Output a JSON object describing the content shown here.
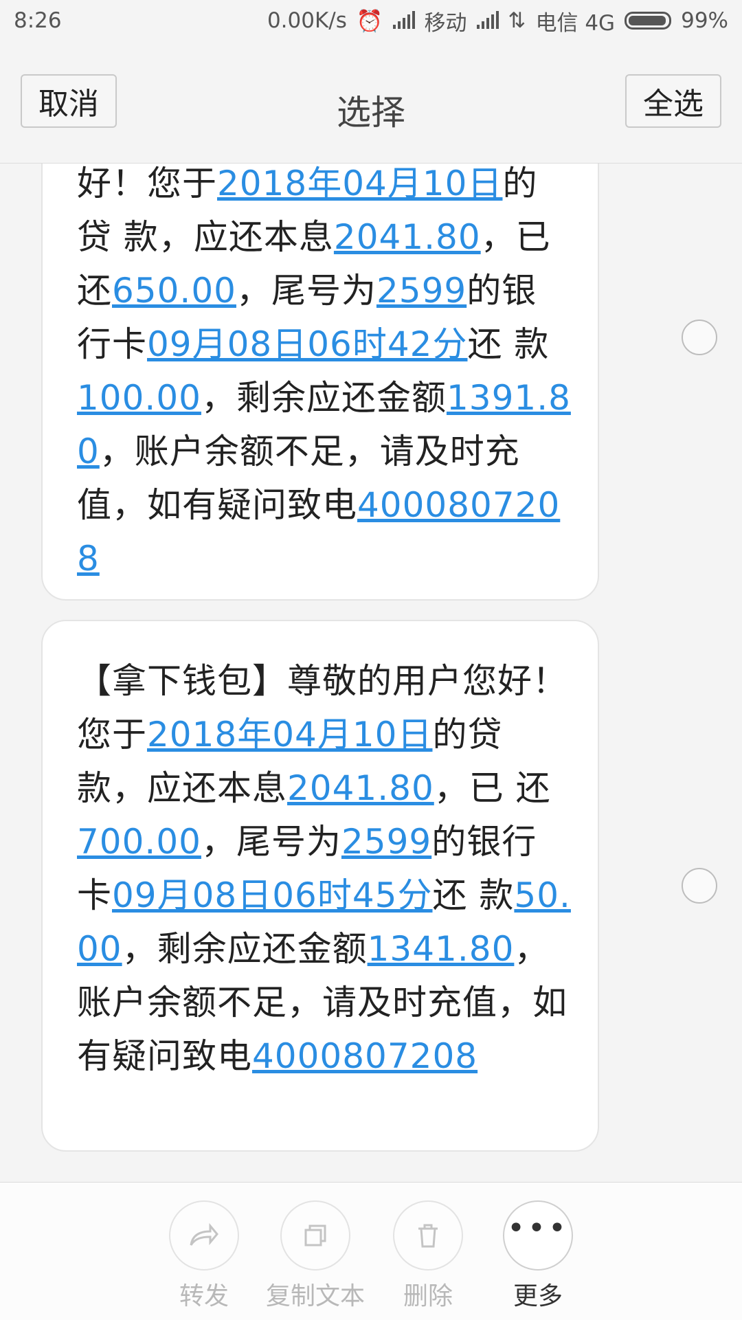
{
  "status_bar": {
    "time": "8:26",
    "speed": "0.00K/s",
    "carrier1": "移动",
    "carrier2": "电信 4G",
    "battery": "99%"
  },
  "title_bar": {
    "cancel_label": "取消",
    "title": "选择",
    "select_all_label": "全选"
  },
  "messages": [
    {
      "segments": [
        {
          "t": "好！您于"
        },
        {
          "t": "2018年04月10日",
          "link": true
        },
        {
          "t": "的贷 款，应还本息"
        },
        {
          "t": "2041.80",
          "link": true
        },
        {
          "t": "，已 还"
        },
        {
          "t": "650.00",
          "link": true
        },
        {
          "t": "，尾号为"
        },
        {
          "t": "2599",
          "link": true
        },
        {
          "t": "的银行卡"
        },
        {
          "t": "09月08日06时42分",
          "link": true
        },
        {
          "t": "还 款"
        },
        {
          "t": "100.00",
          "link": true
        },
        {
          "t": "，剩余应还金额"
        },
        {
          "t": "1391.80",
          "link": true
        },
        {
          "t": "，账户余额不足，请及时充值，如有疑问致电"
        },
        {
          "t": "4000807208",
          "link": true
        }
      ]
    },
    {
      "segments": [
        {
          "t": "【拿下钱包】尊敬的用户您好！您于"
        },
        {
          "t": "2018年04月10日",
          "link": true
        },
        {
          "t": "的贷 款，应还本息"
        },
        {
          "t": "2041.80",
          "link": true
        },
        {
          "t": "，已 还"
        },
        {
          "t": "700.00",
          "link": true
        },
        {
          "t": "，尾号为"
        },
        {
          "t": "2599",
          "link": true
        },
        {
          "t": "的银行卡"
        },
        {
          "t": "09月08日06时45分",
          "link": true
        },
        {
          "t": "还 款"
        },
        {
          "t": "50.00",
          "link": true
        },
        {
          "t": "，剩余应还金额"
        },
        {
          "t": "1341.80",
          "link": true
        },
        {
          "t": "，账户余额不足，请及时充值，如有疑问致电"
        },
        {
          "t": "4000807208",
          "link": true
        }
      ]
    }
  ],
  "bottom_actions": {
    "forward_label": "转发",
    "copy_label": "复制文本",
    "delete_label": "删除",
    "more_label": "更多"
  },
  "colors": {
    "link": "#2a8de2",
    "background": "#f4f4f4"
  }
}
